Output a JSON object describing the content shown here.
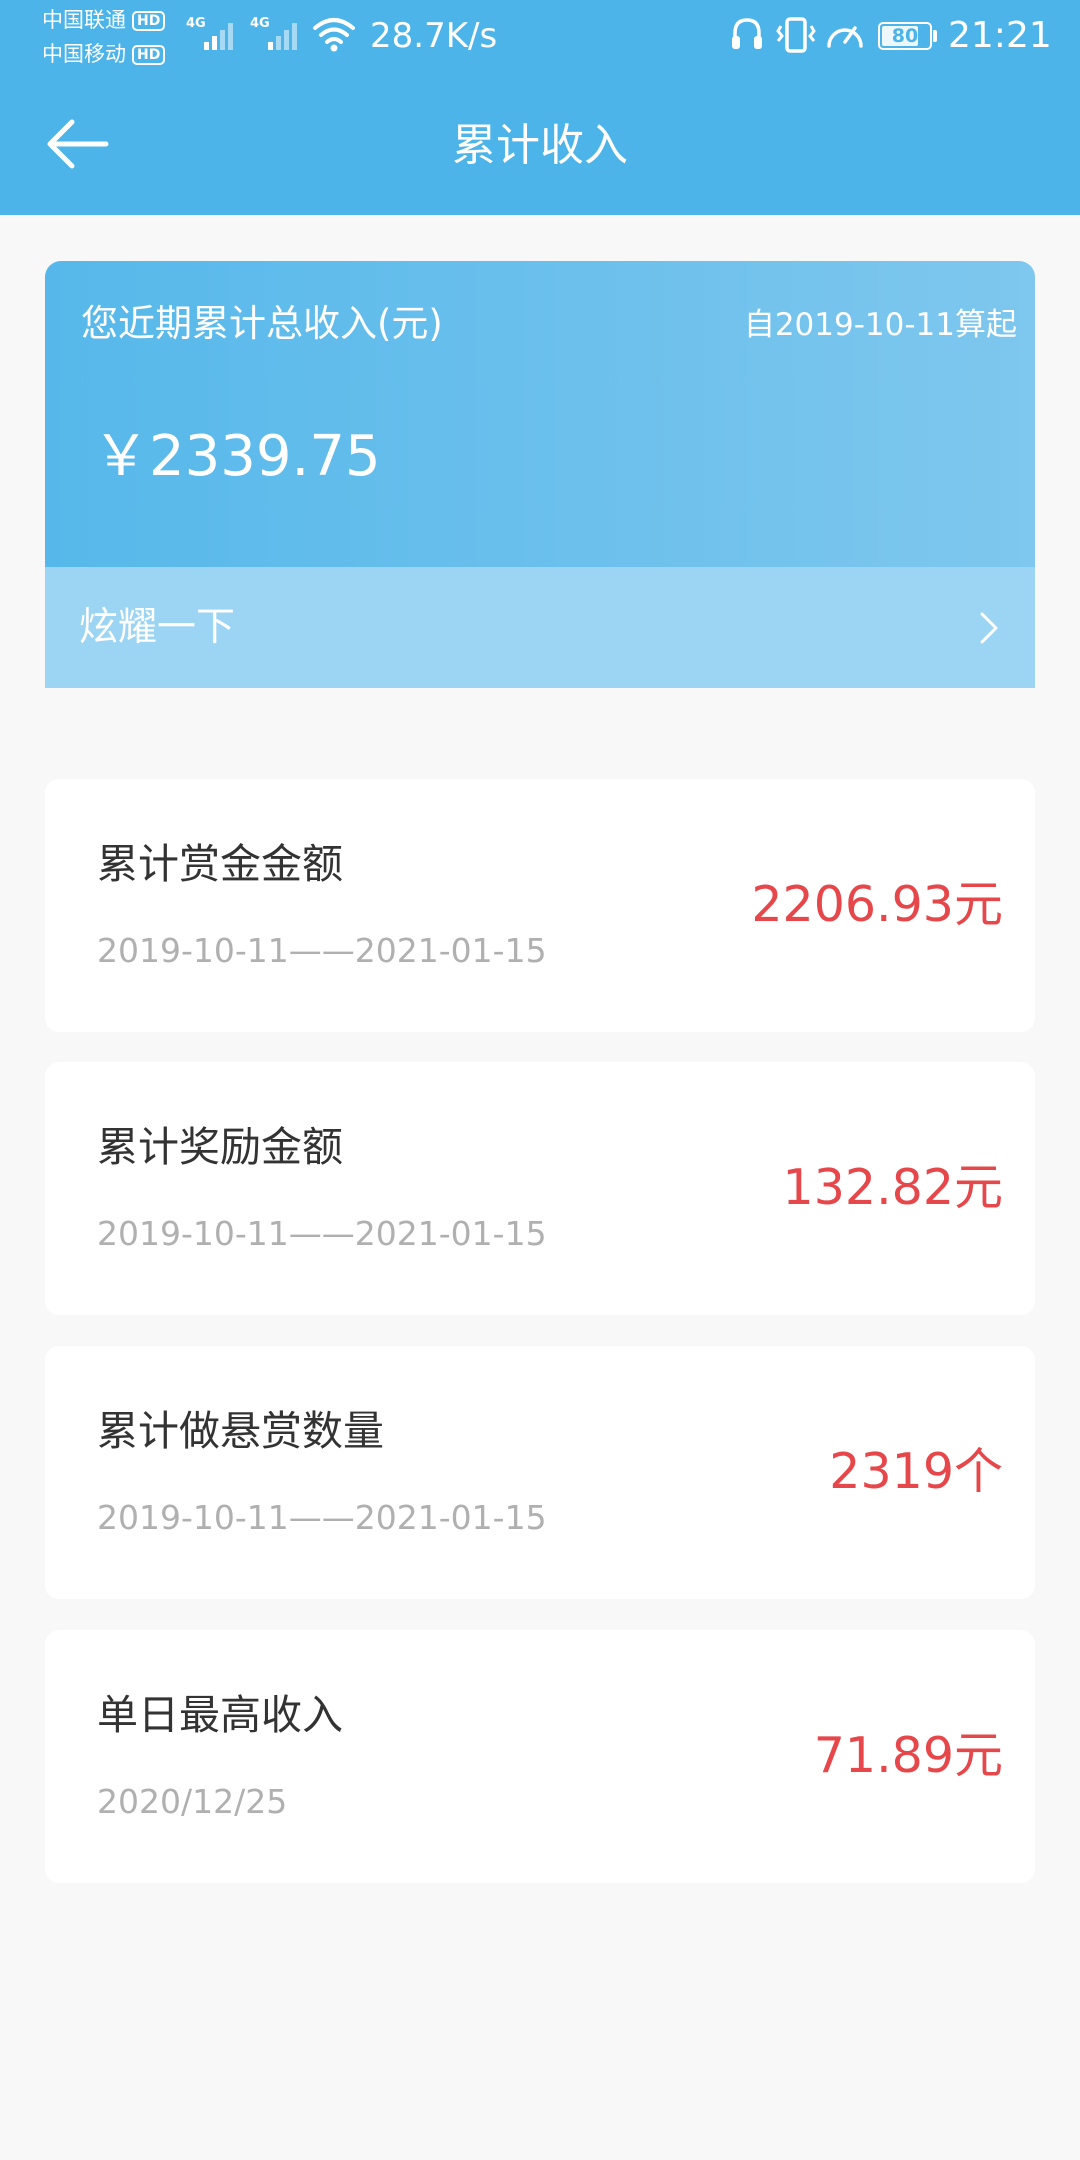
{
  "status_bar": {
    "carrier_1": "中国联通",
    "carrier_2": "中国移动",
    "hd_badge": "HD",
    "network_type": "4G",
    "net_speed": "28.7K/s",
    "battery": "80",
    "battery_fraction": 0.8,
    "time": "21:21"
  },
  "header": {
    "title": "累计收入",
    "back_icon": "back-arrow-icon"
  },
  "summary": {
    "label": "您近期累计总收入(元)",
    "since": "自2019-10-11算起",
    "amount": "￥2339.75",
    "show_off": "炫耀一下"
  },
  "stats": [
    {
      "title": "累计赏金金额",
      "range": "2019-10-11——2021-01-15",
      "value": "2206.93元"
    },
    {
      "title": "累计奖励金额",
      "range": "2019-10-11——2021-01-15",
      "value": "132.82元"
    },
    {
      "title": "累计做悬赏数量",
      "range": "2019-10-11——2021-01-15",
      "value": "2319个"
    },
    {
      "title": "单日最高收入",
      "range": "2020/12/25",
      "value": "71.89元"
    }
  ],
  "colors": {
    "header_bg": "#4cb4e8",
    "accent_value": "#e6474a",
    "page_bg": "#f8f8f8"
  }
}
